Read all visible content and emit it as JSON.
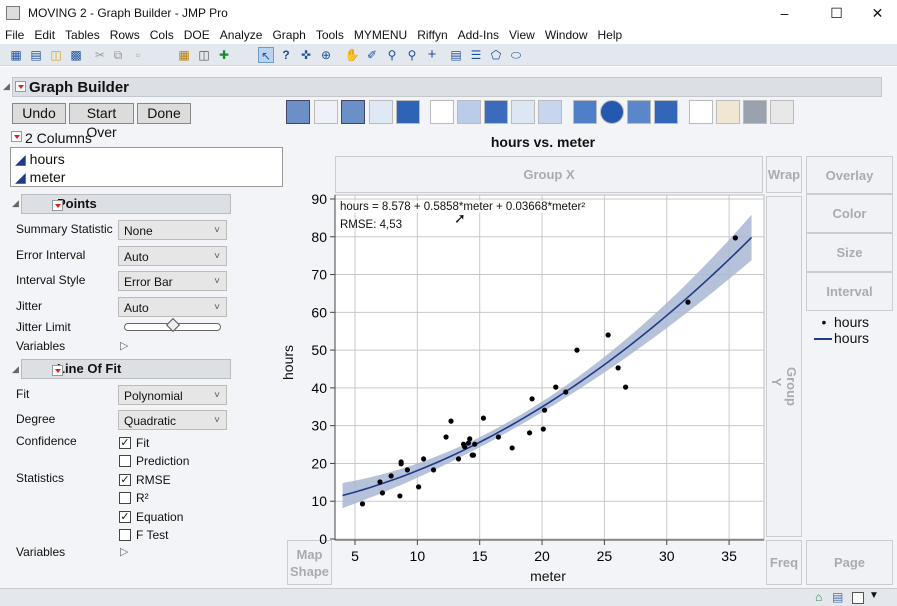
{
  "window": {
    "title": "MOVING 2 - Graph Builder - JMP Pro"
  },
  "menu": [
    "File",
    "Edit",
    "Tables",
    "Rows",
    "Cols",
    "DOE",
    "Analyze",
    "Graph",
    "Tools",
    "MYMENU",
    "Riffyn",
    "Add-Ins",
    "View",
    "Window",
    "Help"
  ],
  "graph_builder": {
    "title": "Graph Builder",
    "undo": "Undo",
    "start_over": "Start Over",
    "done": "Done"
  },
  "columns": {
    "header": "2 Columns",
    "items": [
      "hours",
      "meter"
    ]
  },
  "points": {
    "title": "Points",
    "summary_statistic_label": "Summary Statistic",
    "summary_statistic": "None",
    "error_interval_label": "Error Interval",
    "error_interval": "Auto",
    "interval_style_label": "Interval Style",
    "interval_style": "Error Bar",
    "jitter_label": "Jitter",
    "jitter": "Auto",
    "jitter_limit_label": "Jitter Limit",
    "jitter_limit": 0.5,
    "variables_label": "Variables"
  },
  "line_of_fit": {
    "title": "Line Of Fit",
    "fit_label": "Fit",
    "fit": "Polynomial",
    "degree_label": "Degree",
    "degree": "Quadratic",
    "confidence_label": "Confidence",
    "statistics_label": "Statistics",
    "variables_label": "Variables",
    "options": [
      {
        "label": "Fit",
        "checked": true
      },
      {
        "label": "Prediction",
        "checked": false
      },
      {
        "label": "RMSE",
        "checked": true
      },
      {
        "label": "R²",
        "checked": false
      },
      {
        "label": "Equation",
        "checked": true
      },
      {
        "label": "F Test",
        "checked": false
      }
    ]
  },
  "zones": {
    "group_x": "Group X",
    "wrap": "Wrap",
    "overlay": "Overlay",
    "color": "Color",
    "size": "Size",
    "interval": "Interval",
    "group_y": "Group Y",
    "freq": "Freq",
    "page": "Page",
    "map_shape_1": "Map",
    "map_shape_2": "Shape"
  },
  "legend": [
    "hours",
    "hours"
  ],
  "chart_data": {
    "type": "scatter",
    "title": "hours vs. meter",
    "xlabel": "meter",
    "ylabel": "hours",
    "xlim": [
      3.5,
      38
    ],
    "ylim": [
      0,
      90
    ],
    "xticks": [
      5,
      10,
      15,
      20,
      25,
      30,
      35
    ],
    "yticks": [
      0,
      10,
      20,
      30,
      40,
      50,
      60,
      70,
      80,
      90
    ],
    "grid": true,
    "equation": "hours = 8.578 + 0.5858*meter + 0.03668*meter²",
    "rmse": "RMSE: 4,53",
    "fit": {
      "type": "quadratic",
      "coef": [
        8.578,
        0.5858,
        0.03668
      ],
      "xrange": [
        4.0,
        36.8
      ],
      "confidence_band": true
    },
    "points": [
      [
        5.6,
        9.3
      ],
      [
        7.0,
        15.1
      ],
      [
        7.2,
        12.2
      ],
      [
        7.9,
        16.7
      ],
      [
        8.6,
        11.4
      ],
      [
        8.7,
        20.4
      ],
      [
        8.7,
        19.9
      ],
      [
        9.2,
        18.3
      ],
      [
        10.1,
        13.8
      ],
      [
        10.5,
        21.2
      ],
      [
        11.3,
        18.3
      ],
      [
        12.3,
        27.0
      ],
      [
        12.7,
        31.2
      ],
      [
        13.3,
        21.2
      ],
      [
        13.7,
        25.1
      ],
      [
        13.8,
        24.4
      ],
      [
        14.1,
        25.4
      ],
      [
        14.2,
        26.5
      ],
      [
        14.4,
        22.2
      ],
      [
        14.5,
        22.2
      ],
      [
        14.6,
        25.1
      ],
      [
        15.3,
        32.0
      ],
      [
        16.5,
        27.0
      ],
      [
        17.6,
        24.1
      ],
      [
        19.0,
        28.1
      ],
      [
        19.2,
        37.1
      ],
      [
        20.1,
        29.1
      ],
      [
        20.2,
        34.1
      ],
      [
        21.1,
        40.2
      ],
      [
        21.9,
        38.9
      ],
      [
        22.8,
        50.0
      ],
      [
        25.3,
        54.0
      ],
      [
        26.1,
        45.3
      ],
      [
        26.7,
        40.2
      ],
      [
        31.7,
        62.7
      ],
      [
        35.5,
        79.7
      ]
    ],
    "legend_placement": "right",
    "colors": {
      "line": "#1f3b87",
      "band": "#a9b6d3",
      "points": "#000000"
    }
  }
}
